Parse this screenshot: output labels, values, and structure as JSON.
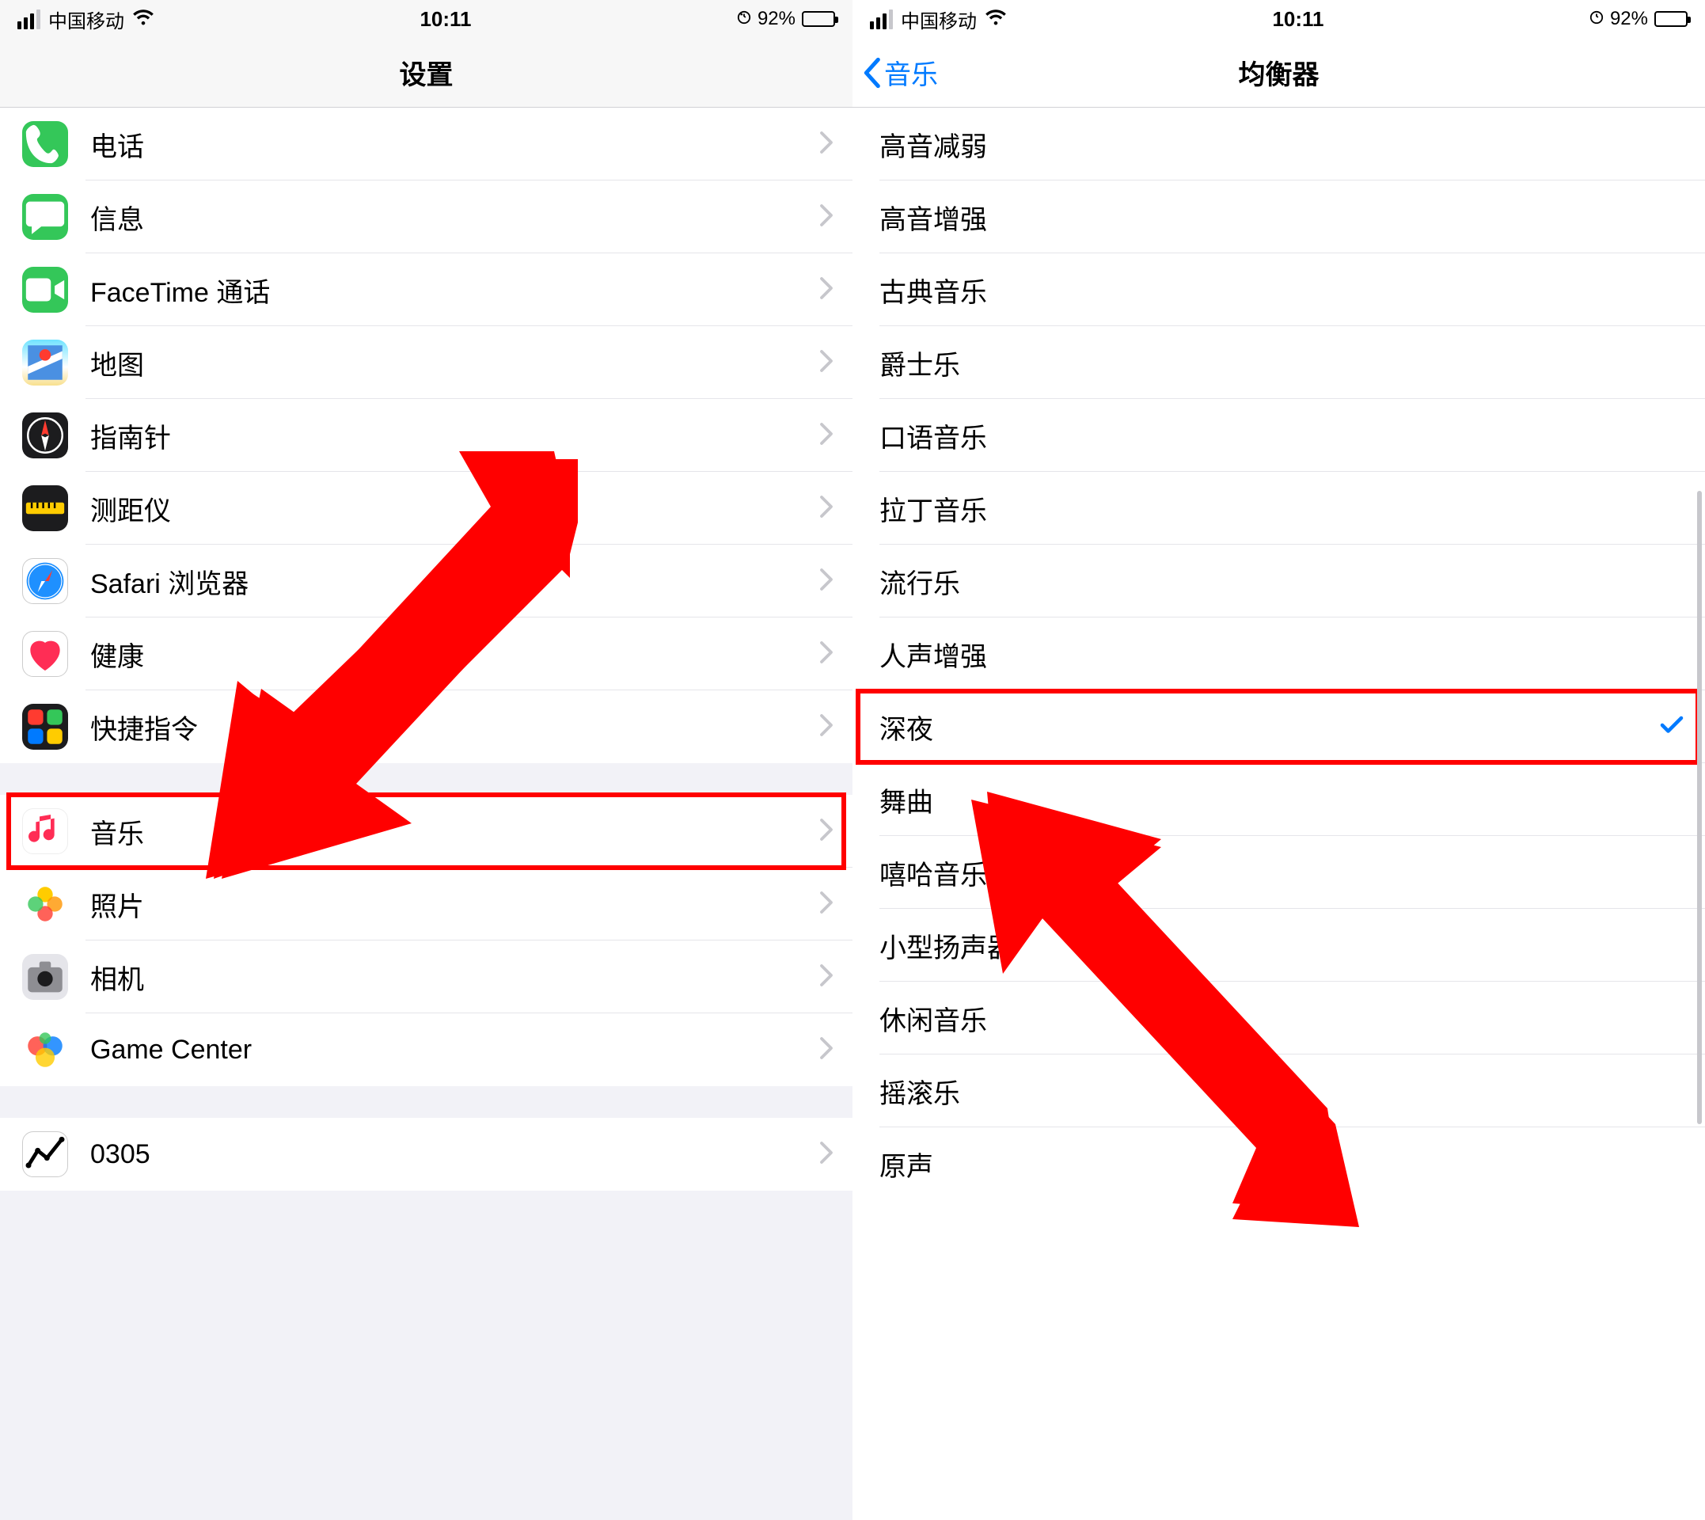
{
  "status": {
    "carrier": "中国移动",
    "time": "10:11",
    "battery_pct": "92%"
  },
  "left": {
    "title": "设置",
    "groups": [
      {
        "items": [
          {
            "id": "phone",
            "label": "电话",
            "icon": "phone"
          },
          {
            "id": "messages",
            "label": "信息",
            "icon": "msg"
          },
          {
            "id": "facetime",
            "label": "FaceTime 通话",
            "icon": "facetime"
          },
          {
            "id": "maps",
            "label": "地图",
            "icon": "maps"
          },
          {
            "id": "compass",
            "label": "指南针",
            "icon": "compass"
          },
          {
            "id": "measure",
            "label": "测距仪",
            "icon": "measure"
          },
          {
            "id": "safari",
            "label": "Safari 浏览器",
            "icon": "safari"
          },
          {
            "id": "health",
            "label": "健康",
            "icon": "health"
          },
          {
            "id": "shortcuts",
            "label": "快捷指令",
            "icon": "shortcuts"
          }
        ]
      },
      {
        "items": [
          {
            "id": "music",
            "label": "音乐",
            "icon": "music",
            "highlight": true
          },
          {
            "id": "photos",
            "label": "照片",
            "icon": "photos"
          },
          {
            "id": "camera",
            "label": "相机",
            "icon": "camera"
          },
          {
            "id": "gamecenter",
            "label": "Game Center",
            "icon": "gamecenter"
          }
        ]
      },
      {
        "items": [
          {
            "id": "stocks",
            "label": "0305",
            "icon": "stocks"
          }
        ]
      }
    ]
  },
  "right": {
    "back_label": "音乐",
    "title": "均衡器",
    "items": [
      {
        "id": "treble-reduce",
        "label": "高音减弱"
      },
      {
        "id": "treble-boost",
        "label": "高音增强"
      },
      {
        "id": "classical",
        "label": "古典音乐"
      },
      {
        "id": "jazz",
        "label": "爵士乐"
      },
      {
        "id": "spoken",
        "label": "口语音乐"
      },
      {
        "id": "latin",
        "label": "拉丁音乐"
      },
      {
        "id": "pop",
        "label": "流行乐"
      },
      {
        "id": "vocal",
        "label": "人声增强"
      },
      {
        "id": "late-night",
        "label": "深夜",
        "selected": true,
        "highlight": true
      },
      {
        "id": "dance",
        "label": "舞曲"
      },
      {
        "id": "hiphop",
        "label": "嘻哈音乐"
      },
      {
        "id": "small-speakers",
        "label": "小型扬声器"
      },
      {
        "id": "lounge",
        "label": "休闲音乐"
      },
      {
        "id": "rock",
        "label": "摇滚乐"
      },
      {
        "id": "acoustic",
        "label": "原声"
      }
    ]
  },
  "annotations": {
    "arrow_color": "#ff0000"
  }
}
